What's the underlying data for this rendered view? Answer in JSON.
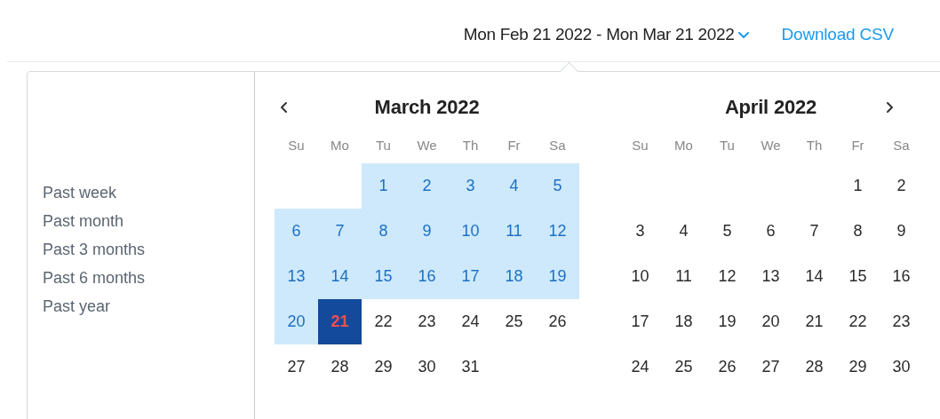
{
  "header": {
    "date_range": "Mon Feb 21 2022 - Mon Mar 21 2022",
    "download_link": "Download CSV"
  },
  "presets": [
    "Past week",
    "Past month",
    "Past 3 months",
    "Past 6 months",
    "Past year"
  ],
  "months": [
    {
      "title": "March 2022",
      "weekdays": [
        "Su",
        "Mo",
        "Tu",
        "We",
        "Th",
        "Fr",
        "Sa"
      ],
      "weeks": [
        {
          "leading_blanks": true,
          "days": [
            {
              "label": "1",
              "in_range": true,
              "selected": false
            },
            {
              "label": "2",
              "in_range": true,
              "selected": false
            },
            {
              "label": "3",
              "in_range": true,
              "selected": false
            },
            {
              "label": "4",
              "in_range": true,
              "selected": false
            },
            {
              "label": "5",
              "in_range": true,
              "selected": false
            }
          ]
        },
        {
          "days": [
            {
              "label": "6",
              "in_range": true,
              "selected": false
            },
            {
              "label": "7",
              "in_range": true,
              "selected": false
            },
            {
              "label": "8",
              "in_range": true,
              "selected": false
            },
            {
              "label": "9",
              "in_range": true,
              "selected": false
            },
            {
              "label": "10",
              "in_range": true,
              "selected": false
            },
            {
              "label": "11",
              "in_range": true,
              "selected": false
            },
            {
              "label": "12",
              "in_range": true,
              "selected": false
            }
          ]
        },
        {
          "days": [
            {
              "label": "13",
              "in_range": true,
              "selected": false
            },
            {
              "label": "14",
              "in_range": true,
              "selected": false
            },
            {
              "label": "15",
              "in_range": true,
              "selected": false
            },
            {
              "label": "16",
              "in_range": true,
              "selected": false
            },
            {
              "label": "17",
              "in_range": true,
              "selected": false
            },
            {
              "label": "18",
              "in_range": true,
              "selected": false
            },
            {
              "label": "19",
              "in_range": true,
              "selected": false
            }
          ]
        },
        {
          "days": [
            {
              "label": "20",
              "in_range": true,
              "selected": false
            },
            {
              "label": "21",
              "in_range": false,
              "selected": true
            },
            {
              "label": "22",
              "in_range": false,
              "selected": false
            },
            {
              "label": "23",
              "in_range": false,
              "selected": false
            },
            {
              "label": "24",
              "in_range": false,
              "selected": false
            },
            {
              "label": "25",
              "in_range": false,
              "selected": false
            },
            {
              "label": "26",
              "in_range": false,
              "selected": false
            }
          ]
        },
        {
          "leading_blanks": false,
          "days": [
            {
              "label": "27",
              "in_range": false,
              "selected": false
            },
            {
              "label": "28",
              "in_range": false,
              "selected": false
            },
            {
              "label": "29",
              "in_range": false,
              "selected": false
            },
            {
              "label": "30",
              "in_range": false,
              "selected": false
            },
            {
              "label": "31",
              "in_range": false,
              "selected": false
            }
          ]
        }
      ]
    },
    {
      "title": "April 2022",
      "weekdays": [
        "Su",
        "Mo",
        "Tu",
        "We",
        "Th",
        "Fr",
        "Sa"
      ],
      "weeks": [
        {
          "leading_blanks": true,
          "days": [
            {
              "label": "1",
              "in_range": false,
              "selected": false
            },
            {
              "label": "2",
              "in_range": false,
              "selected": false
            }
          ]
        },
        {
          "days": [
            {
              "label": "3",
              "in_range": false,
              "selected": false
            },
            {
              "label": "4",
              "in_range": false,
              "selected": false
            },
            {
              "label": "5",
              "in_range": false,
              "selected": false
            },
            {
              "label": "6",
              "in_range": false,
              "selected": false
            },
            {
              "label": "7",
              "in_range": false,
              "selected": false
            },
            {
              "label": "8",
              "in_range": false,
              "selected": false
            },
            {
              "label": "9",
              "in_range": false,
              "selected": false
            }
          ]
        },
        {
          "days": [
            {
              "label": "10",
              "in_range": false,
              "selected": false
            },
            {
              "label": "11",
              "in_range": false,
              "selected": false
            },
            {
              "label": "12",
              "in_range": false,
              "selected": false
            },
            {
              "label": "13",
              "in_range": false,
              "selected": false
            },
            {
              "label": "14",
              "in_range": false,
              "selected": false
            },
            {
              "label": "15",
              "in_range": false,
              "selected": false
            },
            {
              "label": "16",
              "in_range": false,
              "selected": false
            }
          ]
        },
        {
          "days": [
            {
              "label": "17",
              "in_range": false,
              "selected": false
            },
            {
              "label": "18",
              "in_range": false,
              "selected": false
            },
            {
              "label": "19",
              "in_range": false,
              "selected": false
            },
            {
              "label": "20",
              "in_range": false,
              "selected": false
            },
            {
              "label": "21",
              "in_range": false,
              "selected": false
            },
            {
              "label": "22",
              "in_range": false,
              "selected": false
            },
            {
              "label": "23",
              "in_range": false,
              "selected": false
            }
          ]
        },
        {
          "days": [
            {
              "label": "24",
              "in_range": false,
              "selected": false
            },
            {
              "label": "25",
              "in_range": false,
              "selected": false
            },
            {
              "label": "26",
              "in_range": false,
              "selected": false
            },
            {
              "label": "27",
              "in_range": false,
              "selected": false
            },
            {
              "label": "28",
              "in_range": false,
              "selected": false
            },
            {
              "label": "29",
              "in_range": false,
              "selected": false
            },
            {
              "label": "30",
              "in_range": false,
              "selected": false
            }
          ]
        }
      ]
    }
  ]
}
